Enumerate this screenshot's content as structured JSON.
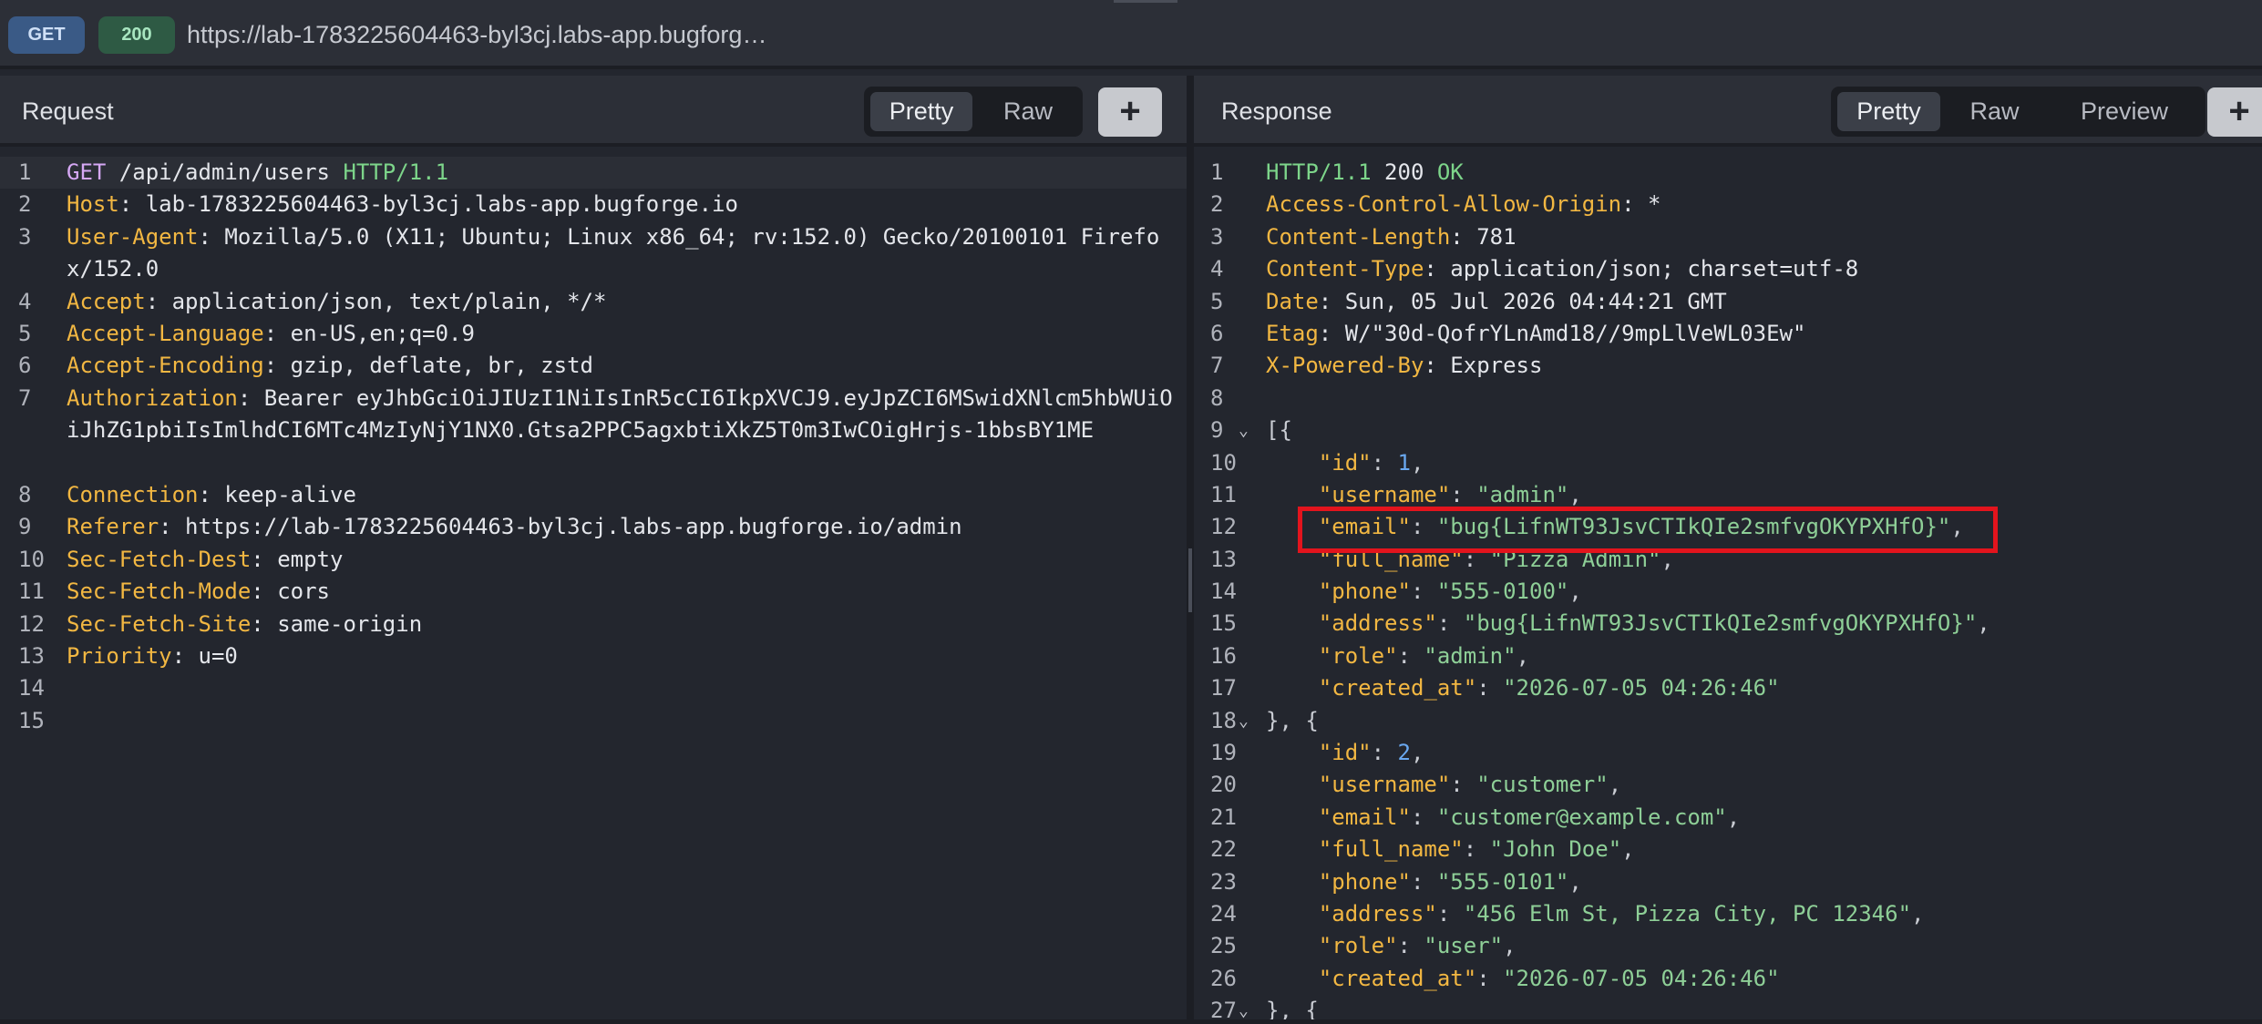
{
  "topbar": {
    "method": "GET",
    "status": "200",
    "url": "https://lab-1783225604463-byl3cj.labs-app.bugforg…"
  },
  "request": {
    "title": "Request",
    "tabs": [
      "Pretty",
      "Raw"
    ],
    "active_tab": "Pretty",
    "add_label": "+",
    "lines": [
      {
        "n": "1",
        "parts": [
          [
            "m",
            "GET"
          ],
          [
            "t",
            " /api/admin/users "
          ],
          [
            "g",
            "HTTP/1.1"
          ]
        ]
      },
      {
        "n": "2",
        "parts": [
          [
            "k",
            "Host"
          ],
          [
            "t",
            ": lab-1783225604463-byl3cj.labs-app.bugforge.io"
          ]
        ]
      },
      {
        "n": "3",
        "parts": [
          [
            "k",
            "User-Agent"
          ],
          [
            "t",
            ": Mozilla/5.0 (X11; Ubuntu; Linux x86_64; rv:152.0) Gecko/20100101 Firefox/152.0"
          ]
        ]
      },
      {
        "n": "4",
        "parts": [
          [
            "k",
            "Accept"
          ],
          [
            "t",
            ": application/json, text/plain, */*"
          ]
        ]
      },
      {
        "n": "5",
        "parts": [
          [
            "k",
            "Accept-Language"
          ],
          [
            "t",
            ": en-US,en;q=0.9"
          ]
        ]
      },
      {
        "n": "6",
        "parts": [
          [
            "k",
            "Accept-Encoding"
          ],
          [
            "t",
            ": gzip, deflate, br, zstd"
          ]
        ]
      },
      {
        "n": "7",
        "parts": [
          [
            "k",
            "Authorization"
          ],
          [
            "t",
            ": Bearer eyJhbGciOiJIUzI1NiIsInR5cCI6IkpXVCJ9.eyJpZCI6MSwidXNlcm5hbWUiOiJhZG1pbiIsImlhdCI6MTc4MzIyNjY1NX0.Gtsa2PPC5agxbtiXkZ5T0m3IwCOigHrjs-1bbsBY1ME"
          ]
        ]
      },
      {
        "n": "8",
        "parts": [
          [
            "k",
            "Connection"
          ],
          [
            "t",
            ": keep-alive"
          ]
        ]
      },
      {
        "n": "9",
        "parts": [
          [
            "k",
            "Referer"
          ],
          [
            "t",
            ": https://lab-1783225604463-byl3cj.labs-app.bugforge.io/admin"
          ]
        ]
      },
      {
        "n": "10",
        "parts": [
          [
            "k",
            "Sec-Fetch-Dest"
          ],
          [
            "t",
            ": empty"
          ]
        ]
      },
      {
        "n": "11",
        "parts": [
          [
            "k",
            "Sec-Fetch-Mode"
          ],
          [
            "t",
            ": cors"
          ]
        ]
      },
      {
        "n": "12",
        "parts": [
          [
            "k",
            "Sec-Fetch-Site"
          ],
          [
            "t",
            ": same-origin"
          ]
        ]
      },
      {
        "n": "13",
        "parts": [
          [
            "k",
            "Priority"
          ],
          [
            "t",
            ": u=0"
          ]
        ]
      },
      {
        "n": "14",
        "parts": []
      },
      {
        "n": "15",
        "parts": []
      }
    ]
  },
  "response": {
    "title": "Response",
    "tabs": [
      "Pretty",
      "Raw",
      "Preview"
    ],
    "active_tab": "Pretty",
    "add_label": "+",
    "lines": [
      {
        "n": "1",
        "parts": [
          [
            "g",
            "HTTP/1.1"
          ],
          [
            "t",
            " 200 "
          ],
          [
            "g",
            "OK"
          ]
        ]
      },
      {
        "n": "2",
        "parts": [
          [
            "k",
            "Access-Control-Allow-Origin"
          ],
          [
            "t",
            ": *"
          ]
        ]
      },
      {
        "n": "3",
        "parts": [
          [
            "k",
            "Content-Length"
          ],
          [
            "t",
            ": 781"
          ]
        ]
      },
      {
        "n": "4",
        "parts": [
          [
            "k",
            "Content-Type"
          ],
          [
            "t",
            ": application/json; charset=utf-8"
          ]
        ]
      },
      {
        "n": "5",
        "parts": [
          [
            "k",
            "Date"
          ],
          [
            "t",
            ": Sun, 05 Jul 2026 04:44:21 GMT"
          ]
        ]
      },
      {
        "n": "6",
        "parts": [
          [
            "k",
            "Etag"
          ],
          [
            "t",
            ": W/\"30d-QofrYLnAmd18//9mpLlVeWL03Ew\""
          ]
        ]
      },
      {
        "n": "7",
        "parts": [
          [
            "k",
            "X-Powered-By"
          ],
          [
            "t",
            ": Express"
          ]
        ]
      },
      {
        "n": "8",
        "parts": []
      },
      {
        "n": "9",
        "fold": true,
        "parts": [
          [
            "p",
            "[{"
          ]
        ]
      },
      {
        "n": "10",
        "parts": [
          [
            "t",
            "    "
          ],
          [
            "k",
            "\"id\""
          ],
          [
            "p",
            ": "
          ],
          [
            "n",
            "1"
          ],
          [
            "p",
            ","
          ]
        ]
      },
      {
        "n": "11",
        "parts": [
          [
            "t",
            "    "
          ],
          [
            "k",
            "\"username\""
          ],
          [
            "p",
            ": "
          ],
          [
            "s",
            "\"admin\""
          ],
          [
            "p",
            ","
          ]
        ]
      },
      {
        "n": "12",
        "parts": [
          [
            "t",
            "    "
          ],
          [
            "k",
            "\"email\""
          ],
          [
            "p",
            ": "
          ],
          [
            "s",
            "\"bug{LifnWT93JsvCTIkQIe2smfvgOKYPXHfO}\""
          ],
          [
            "p",
            ","
          ]
        ]
      },
      {
        "n": "13",
        "parts": [
          [
            "t",
            "    "
          ],
          [
            "k",
            "\"full_name\""
          ],
          [
            "p",
            ": "
          ],
          [
            "s",
            "\"Pizza Admin\""
          ],
          [
            "p",
            ","
          ]
        ]
      },
      {
        "n": "14",
        "parts": [
          [
            "t",
            "    "
          ],
          [
            "k",
            "\"phone\""
          ],
          [
            "p",
            ": "
          ],
          [
            "s",
            "\"555-0100\""
          ],
          [
            "p",
            ","
          ]
        ]
      },
      {
        "n": "15",
        "parts": [
          [
            "t",
            "    "
          ],
          [
            "k",
            "\"address\""
          ],
          [
            "p",
            ": "
          ],
          [
            "s",
            "\"bug{LifnWT93JsvCTIkQIe2smfvgOKYPXHfO}\""
          ],
          [
            "p",
            ","
          ]
        ]
      },
      {
        "n": "16",
        "parts": [
          [
            "t",
            "    "
          ],
          [
            "k",
            "\"role\""
          ],
          [
            "p",
            ": "
          ],
          [
            "s",
            "\"admin\""
          ],
          [
            "p",
            ","
          ]
        ]
      },
      {
        "n": "17",
        "parts": [
          [
            "t",
            "    "
          ],
          [
            "k",
            "\"created_at\""
          ],
          [
            "p",
            ": "
          ],
          [
            "s",
            "\"2026-07-05 04:26:46\""
          ]
        ]
      },
      {
        "n": "18",
        "fold": true,
        "parts": [
          [
            "p",
            "}, {"
          ]
        ]
      },
      {
        "n": "19",
        "parts": [
          [
            "t",
            "    "
          ],
          [
            "k",
            "\"id\""
          ],
          [
            "p",
            ": "
          ],
          [
            "n",
            "2"
          ],
          [
            "p",
            ","
          ]
        ]
      },
      {
        "n": "20",
        "parts": [
          [
            "t",
            "    "
          ],
          [
            "k",
            "\"username\""
          ],
          [
            "p",
            ": "
          ],
          [
            "s",
            "\"customer\""
          ],
          [
            "p",
            ","
          ]
        ]
      },
      {
        "n": "21",
        "parts": [
          [
            "t",
            "    "
          ],
          [
            "k",
            "\"email\""
          ],
          [
            "p",
            ": "
          ],
          [
            "s",
            "\"customer@example.com\""
          ],
          [
            "p",
            ","
          ]
        ]
      },
      {
        "n": "22",
        "parts": [
          [
            "t",
            "    "
          ],
          [
            "k",
            "\"full_name\""
          ],
          [
            "p",
            ": "
          ],
          [
            "s",
            "\"John Doe\""
          ],
          [
            "p",
            ","
          ]
        ]
      },
      {
        "n": "23",
        "parts": [
          [
            "t",
            "    "
          ],
          [
            "k",
            "\"phone\""
          ],
          [
            "p",
            ": "
          ],
          [
            "s",
            "\"555-0101\""
          ],
          [
            "p",
            ","
          ]
        ]
      },
      {
        "n": "24",
        "parts": [
          [
            "t",
            "    "
          ],
          [
            "k",
            "\"address\""
          ],
          [
            "p",
            ": "
          ],
          [
            "s",
            "\"456 Elm St, Pizza City, PC 12346\""
          ],
          [
            "p",
            ","
          ]
        ]
      },
      {
        "n": "25",
        "parts": [
          [
            "t",
            "    "
          ],
          [
            "k",
            "\"role\""
          ],
          [
            "p",
            ": "
          ],
          [
            "s",
            "\"user\""
          ],
          [
            "p",
            ","
          ]
        ]
      },
      {
        "n": "26",
        "parts": [
          [
            "t",
            "    "
          ],
          [
            "k",
            "\"created_at\""
          ],
          [
            "p",
            ": "
          ],
          [
            "s",
            "\"2026-07-05 04:26:46\""
          ]
        ]
      },
      {
        "n": "27",
        "fold": true,
        "parts": [
          [
            "p",
            "}, {"
          ]
        ]
      }
    ]
  },
  "colors": {
    "key": "#f2b742",
    "method": "#d6a8f5",
    "protocol": "#7dd58a",
    "string": "#8ecf97",
    "number": "#6aa8f0",
    "highlight_box": "#e3141d"
  },
  "icons": {
    "fold": "chevron-down-icon",
    "add": "plus-icon"
  }
}
